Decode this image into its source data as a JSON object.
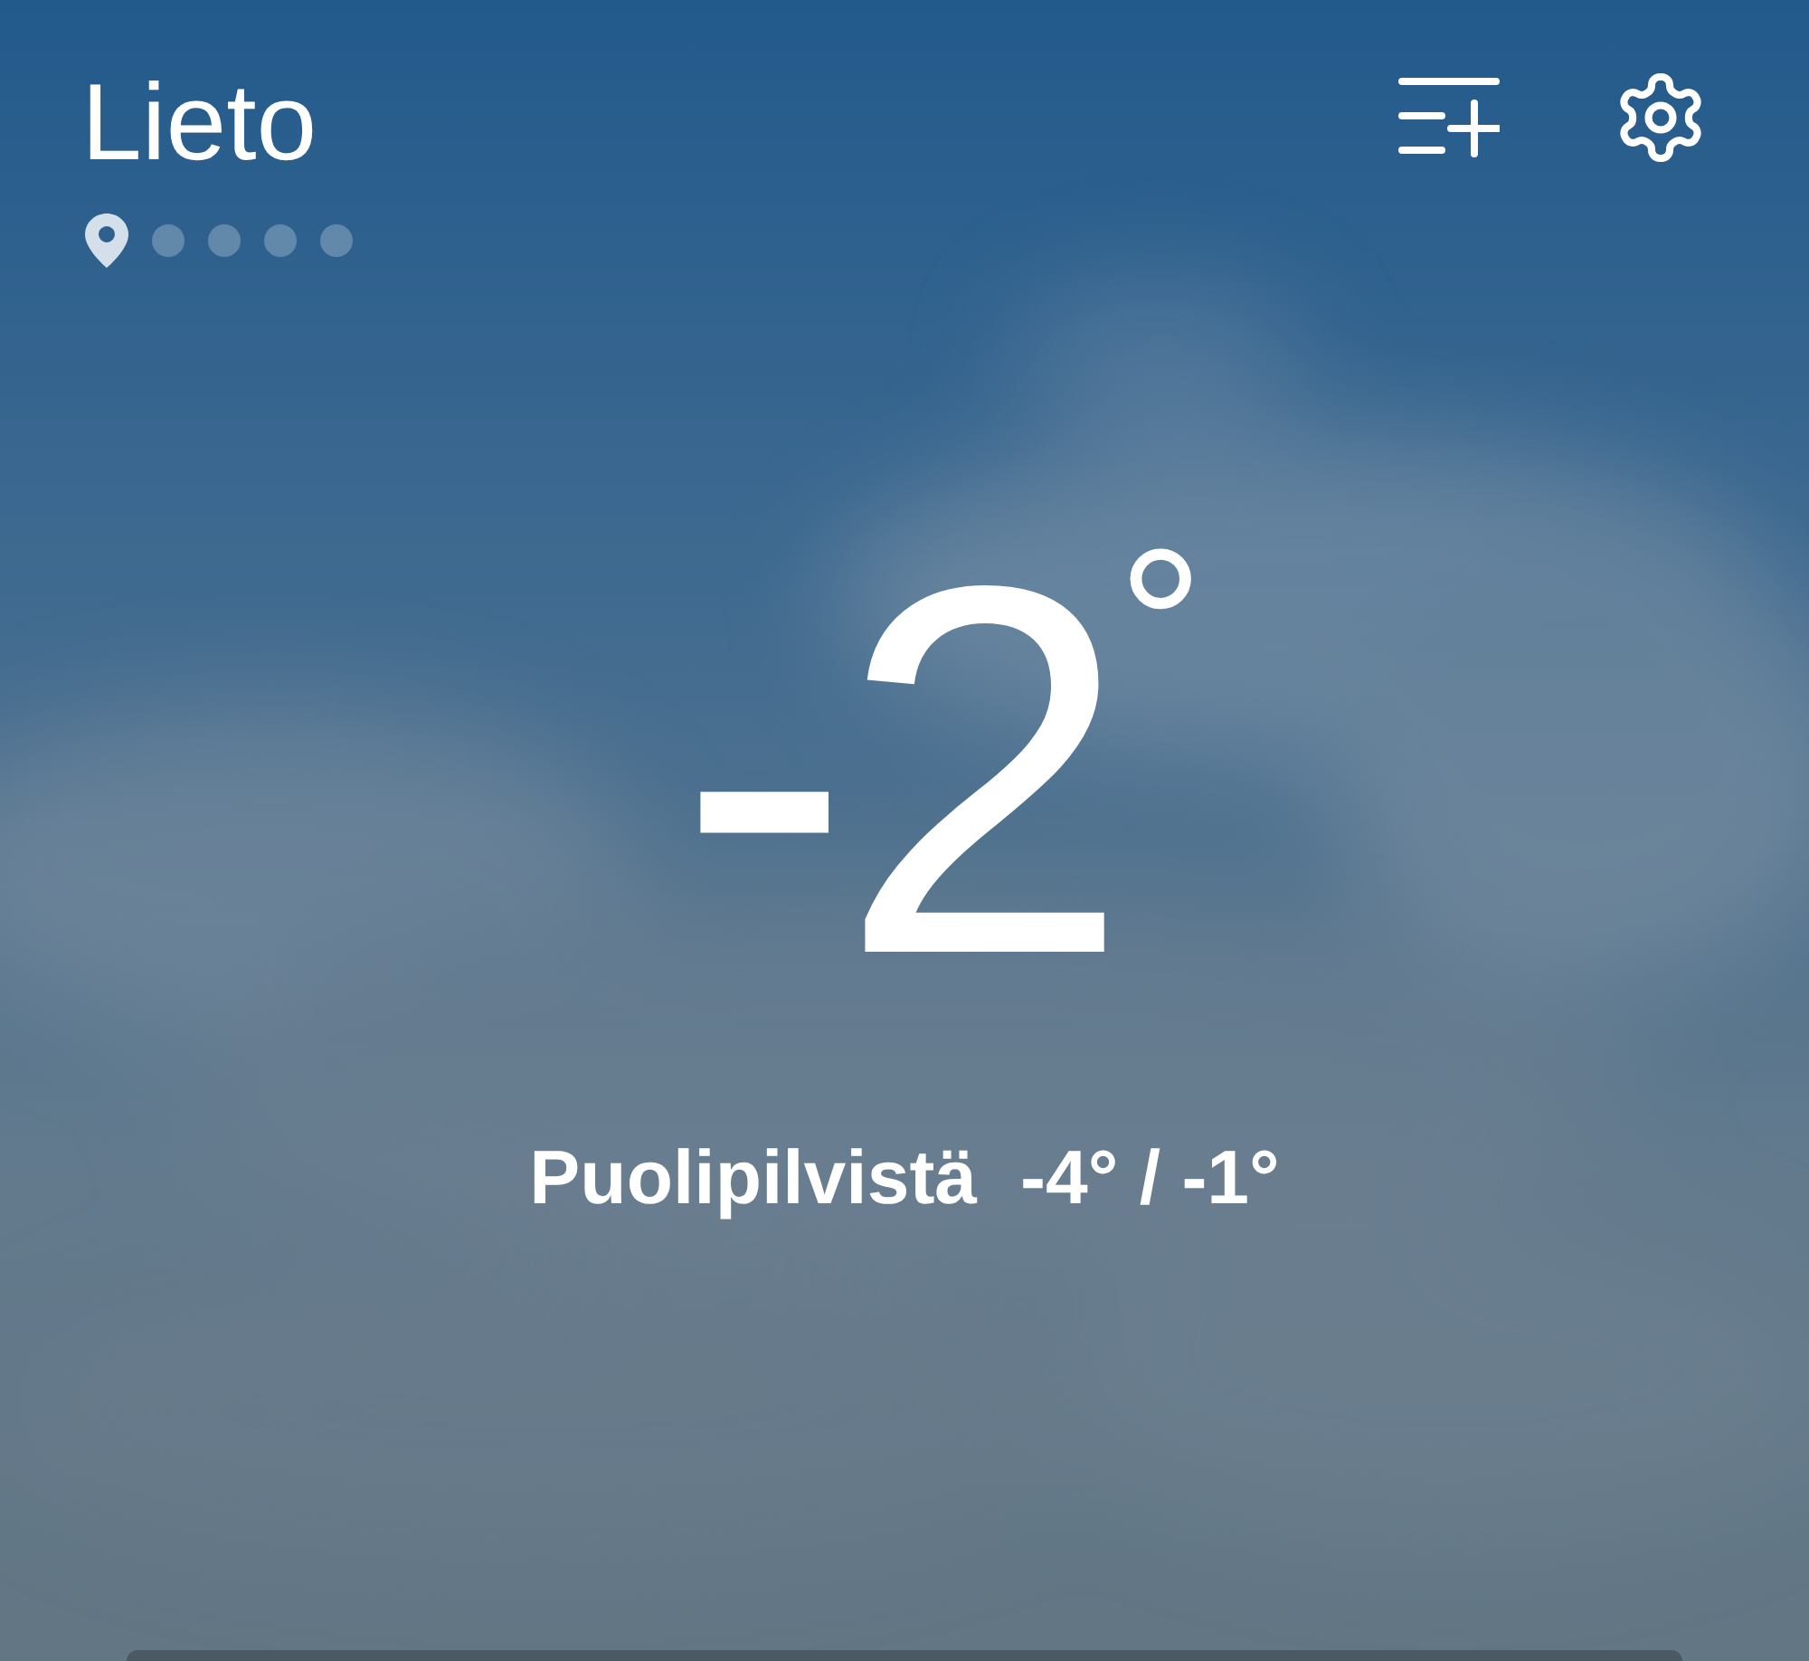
{
  "location": {
    "name": "Lieto"
  },
  "pages": [
    {
      "kind": "location",
      "selected": true
    },
    {
      "kind": "dot",
      "selected": false
    },
    {
      "kind": "dot",
      "selected": false
    },
    {
      "kind": "dot",
      "selected": false
    },
    {
      "kind": "dot",
      "selected": false
    }
  ],
  "current": {
    "temperature": "-2",
    "unit": "°",
    "condition": "Puolipilvistä",
    "range": "-4° / -1°"
  }
}
